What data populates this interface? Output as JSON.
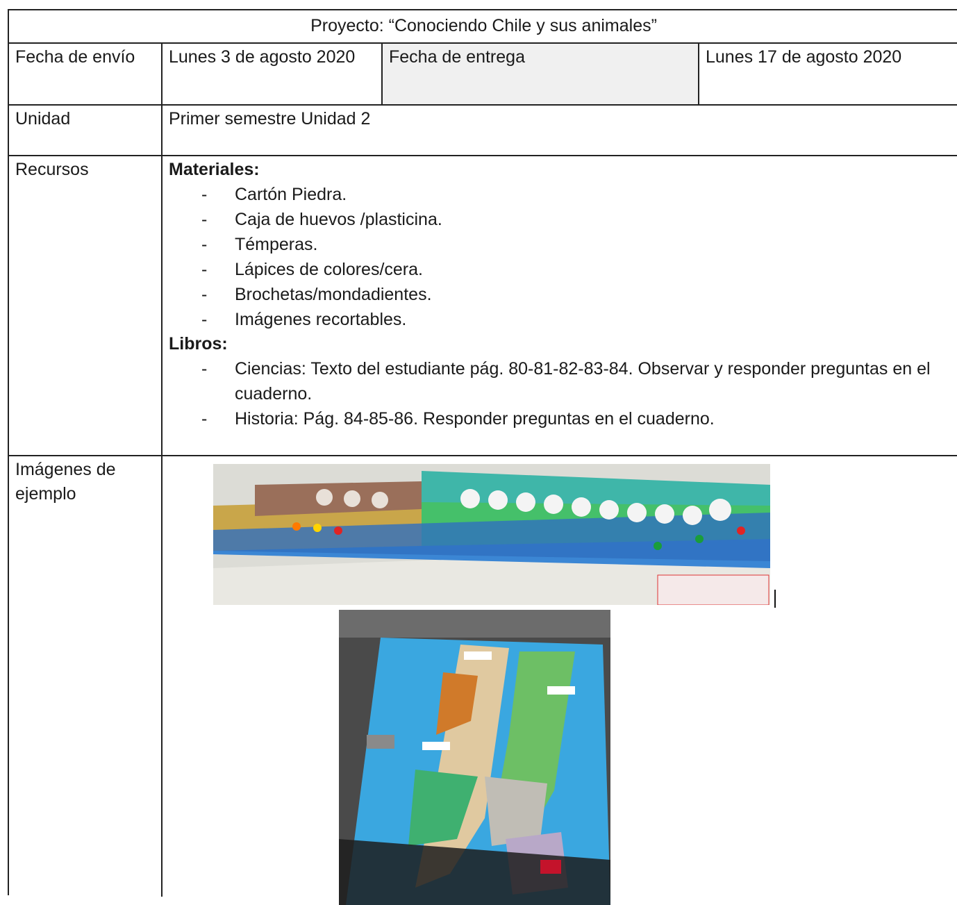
{
  "title": "Proyecto: “Conociendo Chile y sus animales”",
  "dates": {
    "sent_label": "Fecha de envío",
    "sent_value": "Lunes 3 de agosto 2020",
    "due_label": "Fecha de entrega",
    "due_value": "Lunes 17 de agosto 2020"
  },
  "unit": {
    "label": "Unidad",
    "value": "Primer semestre Unidad 2"
  },
  "resources": {
    "label": "Recursos",
    "materials_heading": "Materiales:",
    "materials": [
      "Cartón Piedra.",
      "Caja de huevos /plasticina.",
      "Témperas.",
      "Lápices de colores/cera.",
      "Brochetas/mondadientes.",
      "Imágenes recortables."
    ],
    "books_heading": "Libros:",
    "books": [
      "Ciencias: Texto del estudiante pág. 80-81-82-83-84. Observar y responder preguntas en el cuaderno.",
      "Historia: Pág. 84-85-86. Responder preguntas en el cuaderno."
    ],
    "bullet": "-"
  },
  "images": {
    "label": "Imágenes de ejemplo"
  },
  "colors": {
    "border": "#222222",
    "shaded_cell": "#f0f0f0",
    "ocean_blue": "#3aa7e0",
    "land_green": "#4fc27a",
    "desert_ochre": "#c9a64a"
  }
}
